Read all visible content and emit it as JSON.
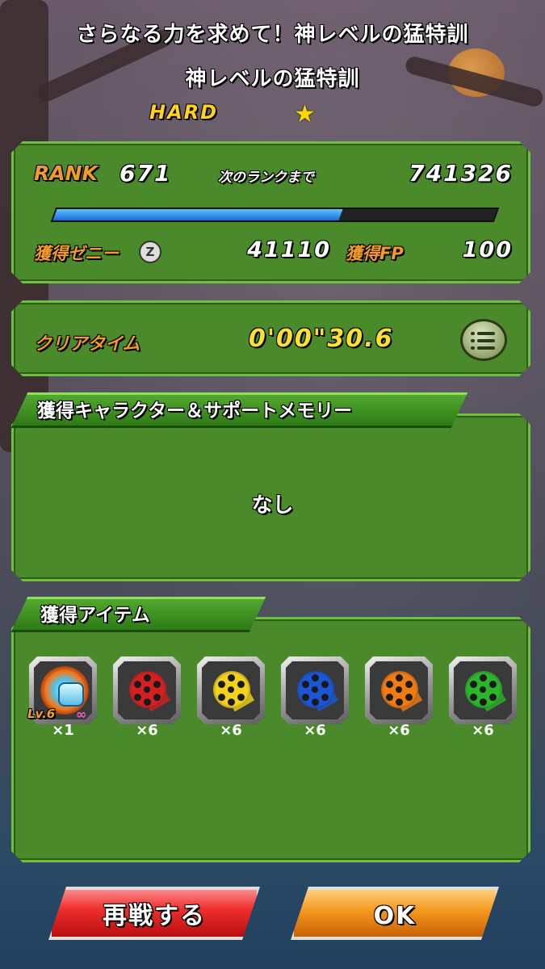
{
  "header": {
    "stage_title": "さらなる力を求めて！神レベルの猛特訓",
    "stage_subtitle": "神レベルの猛特訓",
    "difficulty": "HARD",
    "difficulty_stars": 1
  },
  "rank_panel": {
    "rank_label": "RANK",
    "rank_value": "671",
    "next_rank_label": "次のランクまで",
    "next_rank_value": "741326",
    "exp_progress": 0.65,
    "zeni_label": "獲得ゼニー",
    "zeni_icon": "Z",
    "zeni_value": "41110",
    "fp_label": "獲得FP",
    "fp_value": "100"
  },
  "clear_panel": {
    "label": "クリアタイム",
    "time": "0'00\"30.6",
    "menu_icon": "list-icon"
  },
  "characters_section": {
    "title": "獲得キャラクター＆サポートメモリー",
    "empty_text": "なし"
  },
  "items_section": {
    "title": "獲得アイテム",
    "items": [
      {
        "name": "orb",
        "level": "Lv.6",
        "badge": "∞",
        "quantity": "×1"
      },
      {
        "name": "red-reel",
        "color": "#d42020",
        "quantity": "×6"
      },
      {
        "name": "yellow-reel",
        "color": "#f2d21a",
        "quantity": "×6"
      },
      {
        "name": "blue-reel",
        "color": "#1c56d6",
        "quantity": "×6"
      },
      {
        "name": "orange-reel",
        "color": "#f27a12",
        "quantity": "×6"
      },
      {
        "name": "green-reel",
        "color": "#2bb52b",
        "quantity": "×6"
      }
    ]
  },
  "buttons": {
    "retry_label": "再戦する",
    "ok_label": "OK"
  },
  "colors": {
    "panel_green": "#4a8a2b",
    "accent_orange": "#f29a2a",
    "time_yellow": "#ffe02e",
    "bar_blue": "#1a6ad8"
  }
}
